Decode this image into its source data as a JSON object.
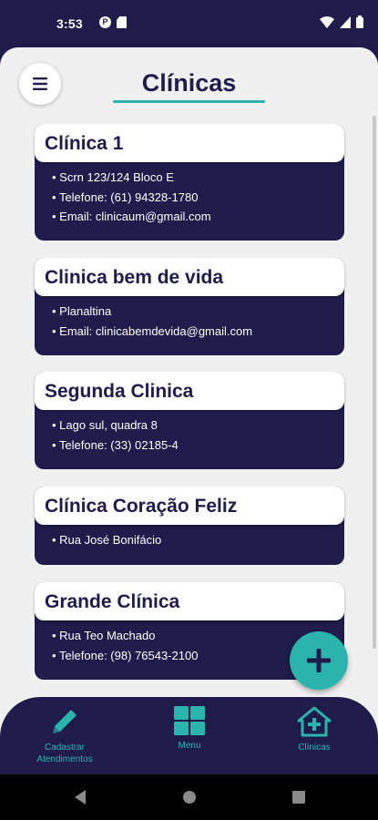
{
  "status_bar": {
    "time": "3:53",
    "left_icons": [
      "notification-icon",
      "sd-card-icon"
    ],
    "right_icons": [
      "wifi-icon",
      "signal-icon",
      "battery-icon"
    ]
  },
  "header": {
    "title": "Clínicas",
    "menu_icon": "hamburger-menu-icon"
  },
  "clinics": [
    {
      "name": "Clínica 1",
      "details": [
        "Scrn 123/124 Bloco E",
        "Telefone: (61) 94328-1780",
        "Email: clinicaum@gmail.com"
      ]
    },
    {
      "name": "Clinica bem de vida",
      "details": [
        "Planaltina",
        "Email: clinicabemdevida@gmail.com"
      ]
    },
    {
      "name": "Segunda Clinica",
      "details": [
        "Lago sul, quadra 8",
        "Telefone: (33) 02185-4"
      ]
    },
    {
      "name": "Clínica Coração Feliz",
      "details": [
        "Rua José Bonifácio"
      ]
    },
    {
      "name": "Grande Clínica",
      "details": [
        "Rua Teo Machado",
        "Telefone: (98) 76543-2100"
      ]
    }
  ],
  "fab": {
    "icon": "plus-icon"
  },
  "bottom_nav": {
    "items": [
      {
        "label": "Cadastrar\nAtendimentos",
        "icon": "pencil-icon"
      },
      {
        "label": "Menu",
        "icon": "grid-icon"
      },
      {
        "label": "Clínicas",
        "icon": "clinic-house-icon"
      }
    ]
  },
  "system_nav": [
    "back-icon",
    "home-icon",
    "recents-icon"
  ],
  "colors": {
    "primary": "#1f1c4c",
    "accent": "#2bb3ad",
    "background": "#f0f0f0",
    "card_header": "#ffffff"
  }
}
